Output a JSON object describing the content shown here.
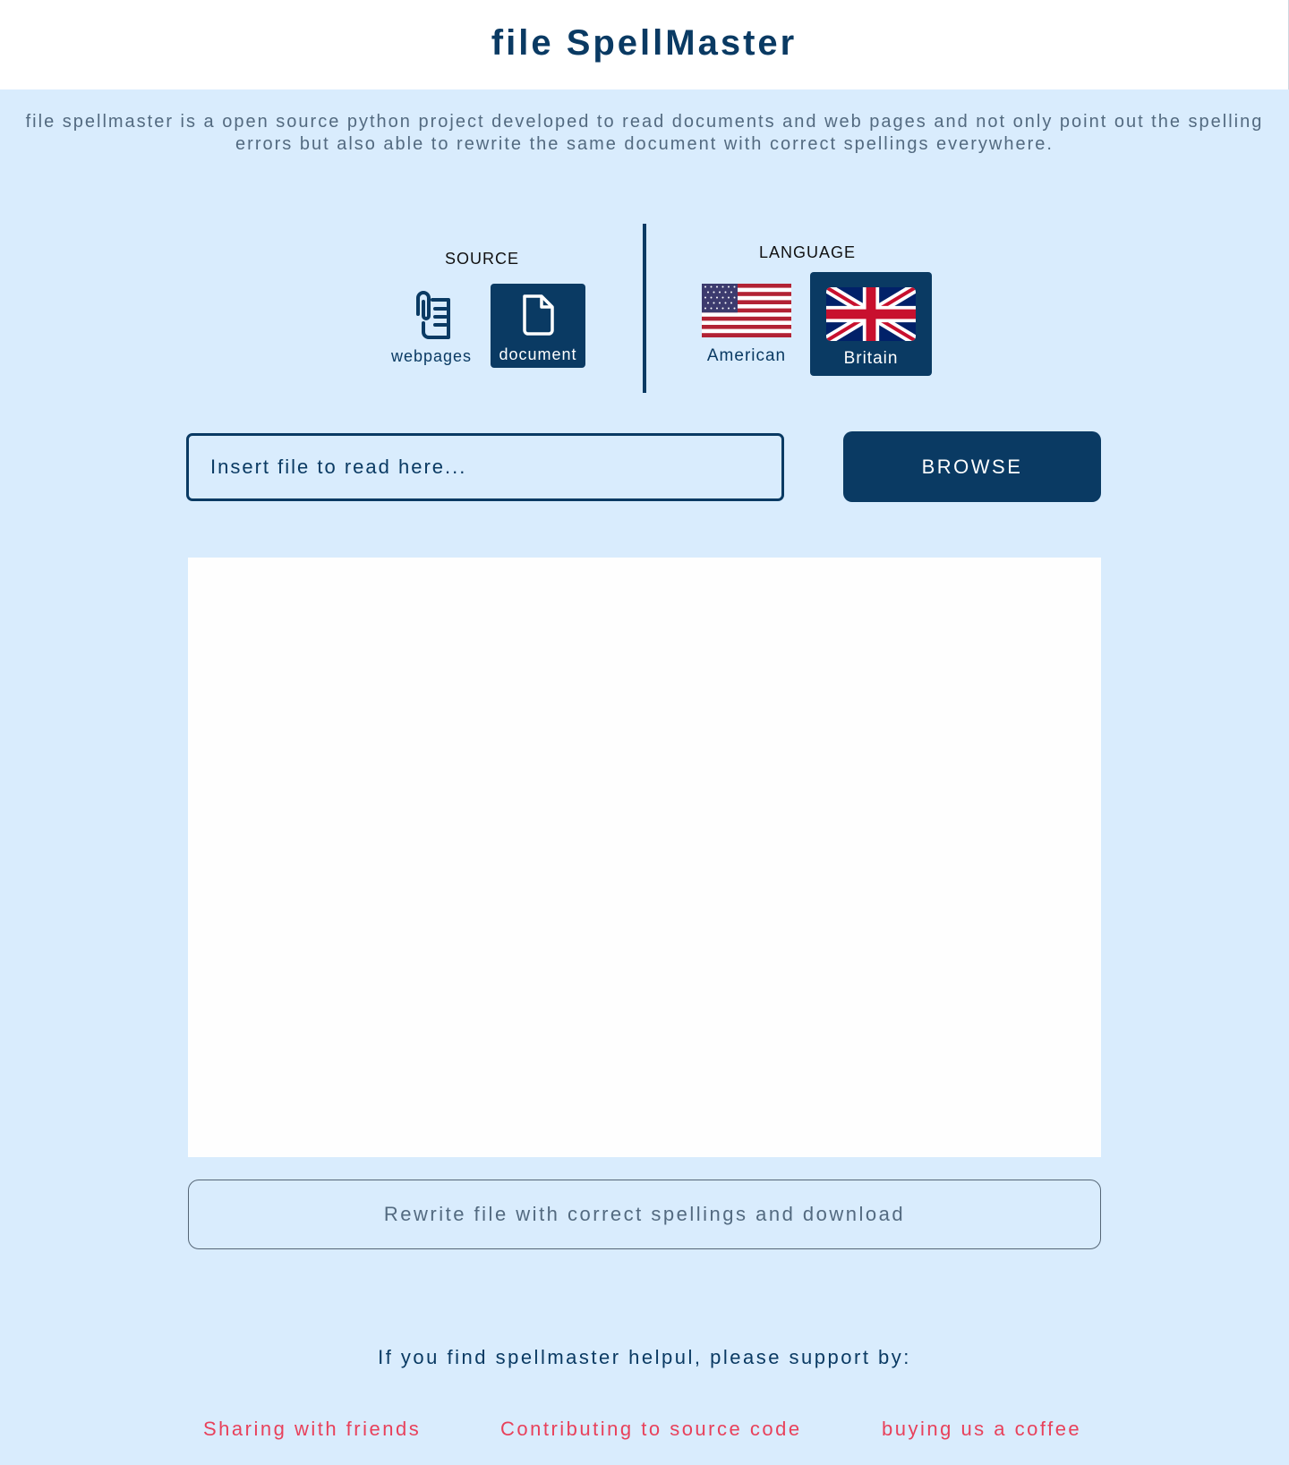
{
  "header": {
    "title": "file SpellMaster"
  },
  "description": "file spellmaster is a open source python project developed to read documents and web pages and not only point out the spelling errors but also able to rewrite the same document with correct spellings everywhere.",
  "source": {
    "label": "SOURCE",
    "options": [
      {
        "label": "webpages",
        "icon": "clipped-pages-icon",
        "selected": false
      },
      {
        "label": "document",
        "icon": "file-icon",
        "selected": true
      }
    ]
  },
  "language": {
    "label": "LANGUAGE",
    "options": [
      {
        "label": "American",
        "icon": "us-flag-icon",
        "selected": false
      },
      {
        "label": "Britain",
        "icon": "uk-flag-icon",
        "selected": true
      }
    ]
  },
  "file_input": {
    "placeholder": "Insert file to read here...",
    "value": ""
  },
  "browse_label": "BROWSE",
  "rewrite_label": "Rewrite file with correct spellings and download",
  "support": {
    "text": "If you find spellmaster helpul, please support by:",
    "links": [
      "Sharing with friends",
      "Contributing to source code",
      "buying us a coffee"
    ]
  },
  "colors": {
    "primary": "#0a3a63",
    "background": "#d9ecfd",
    "link": "#e8415b",
    "muted_text": "#536a80"
  }
}
